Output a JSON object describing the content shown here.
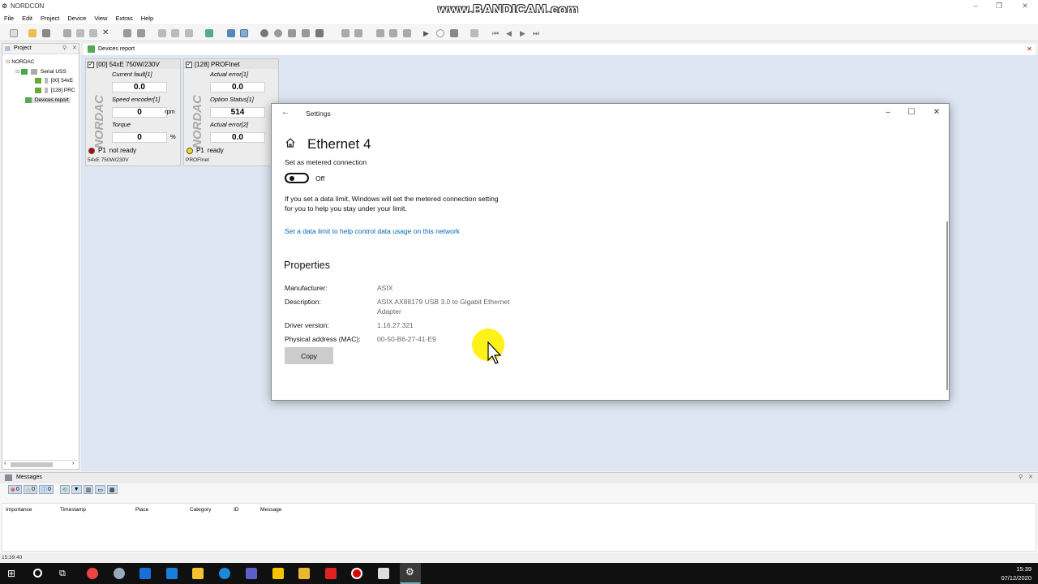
{
  "app": {
    "title": "NORDCON",
    "watermark": "www.BANDICAM.com"
  },
  "menu": [
    "File",
    "Edit",
    "Project",
    "Device",
    "View",
    "Extras",
    "Help"
  ],
  "project_panel": {
    "title": "Project",
    "tree": [
      "NORDAC",
      "Serial USS",
      "[00] 54xE",
      "[128] PRC",
      "Devices report"
    ]
  },
  "devices_tab": {
    "label": "Devices report"
  },
  "cards": [
    {
      "header": "[00] 54xE 750W/230V",
      "logo": "NORDAC",
      "fields": [
        {
          "label": "Current fault[1]",
          "value": "0.0",
          "unit": ""
        },
        {
          "label": "Speed encoder[1]",
          "value": "0",
          "unit": "rpm"
        },
        {
          "label": "Torque",
          "value": "0",
          "unit": "%"
        }
      ],
      "status_param": "P1",
      "status_text": "not ready",
      "status_color": "#c00000",
      "footer": "54xE 750W/230V"
    },
    {
      "header": "[128] PROFInet",
      "logo": "NORDAC",
      "fields": [
        {
          "label": "Actual error[1]",
          "value": "0.0",
          "unit": ""
        },
        {
          "label": "Option Status[1]",
          "value": "514",
          "unit": ""
        },
        {
          "label": "Actual error[2]",
          "value": "0.0",
          "unit": ""
        }
      ],
      "status_param": "P1",
      "status_text": "ready",
      "status_color": "#f0e000",
      "footer": "PROFInet"
    }
  ],
  "settings": {
    "window_title": "Settings",
    "heading": "Ethernet 4",
    "metered_label": "Set as metered connection",
    "toggle_state": "Off",
    "info_line1": "If you set a data limit, Windows will set the metered connection setting",
    "info_line2": "for you to help you stay under your limit.",
    "link": "Set a data limit to help control data usage on this network",
    "properties_title": "Properties",
    "properties": {
      "manufacturer_label": "Manufacturer:",
      "manufacturer": "ASIX",
      "description_label": "Description:",
      "description_line1": "ASIX AX88179 USB 3.0 to Gigabit Ethernet",
      "description_line2": "Adapter",
      "driver_label": "Driver version:",
      "driver": "1.16.27.321",
      "mac_label": "Physical address (MAC):",
      "mac": "00-50-B6-27-41-E9"
    },
    "copy_button": "Copy"
  },
  "messages": {
    "title": "Messages",
    "filters": [
      "0",
      "0",
      "0"
    ],
    "columns": [
      "Importance",
      "Timestamp",
      "Place",
      "Category",
      "ID",
      "Message"
    ]
  },
  "statusbar": {
    "time": "15:39:40"
  },
  "clock": {
    "time": "15:39",
    "date": "07/12/2020"
  }
}
